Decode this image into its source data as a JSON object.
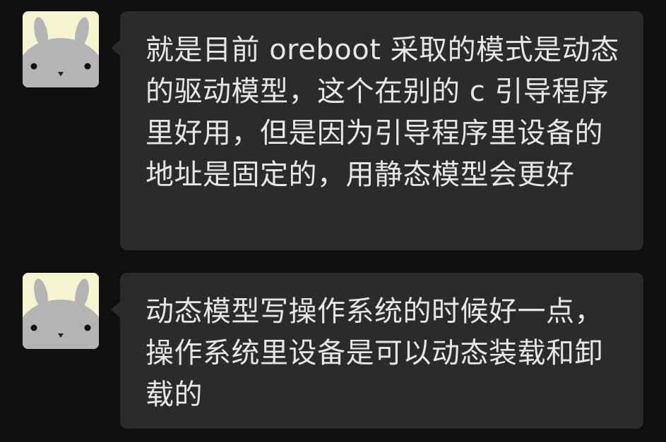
{
  "chat": {
    "messages": [
      {
        "sender_avatar": "bunny-avatar-icon",
        "text": "就是目前 oreboot 采取的模式是动态的驱动模型，这个在别的 c 引导程序里好用，但是因为引导程序里设备的地址是固定的，用静态模型会更好"
      },
      {
        "sender_avatar": "bunny-avatar-icon",
        "text": "动态模型写操作系统的时候好一点，操作系统里设备是可以动态装载和卸载的"
      }
    ]
  },
  "colors": {
    "background": "#0f0f0f",
    "bubble": "#2b2b2b",
    "text": "#e6e6e6",
    "avatar_bg": "#f6f3cf",
    "avatar_face": "#b5b4b4"
  }
}
